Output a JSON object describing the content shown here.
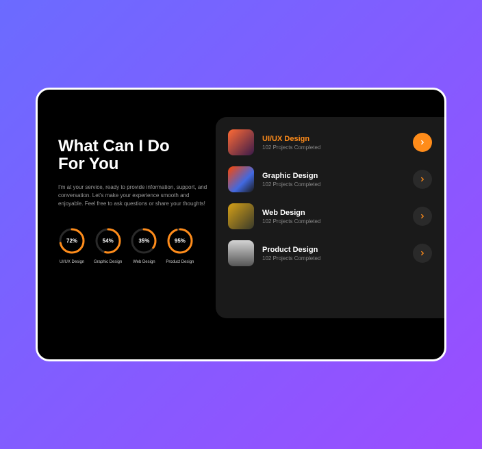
{
  "title_line1": "What Can I Do",
  "title_line2": "For You",
  "description": "I'm at your service, ready to provide information, support, and conversation. Let's make your experience smooth and enjoyable. Feel free to ask questions or share your thoughts!",
  "rings": [
    {
      "name": "UI/UX Design",
      "percent": 72,
      "label": "72%"
    },
    {
      "name": "Graphic Design",
      "percent": 54,
      "label": "54%"
    },
    {
      "name": "Web Design",
      "percent": 35,
      "label": "35%"
    },
    {
      "name": "Product Design",
      "percent": 95,
      "label": "95%"
    }
  ],
  "services": [
    {
      "title": "UI/UX Design",
      "subtitle": "102 Projects Completed",
      "active": true
    },
    {
      "title": "Graphic Design",
      "subtitle": "102 Projects Completed",
      "active": false
    },
    {
      "title": "Web Design",
      "subtitle": "102 Projects Completed",
      "active": false
    },
    {
      "title": "Product Design",
      "subtitle": "102 Projects Completed",
      "active": false
    }
  ]
}
